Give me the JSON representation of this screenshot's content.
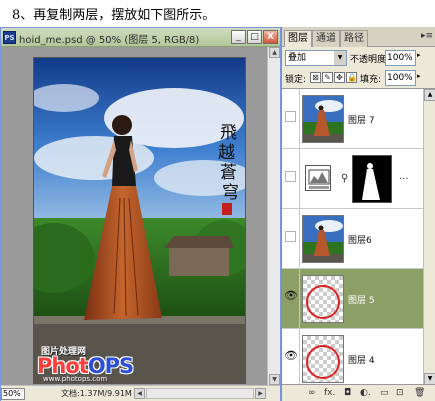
{
  "caption": "8、再复制两层，摆放如下图所示。",
  "document": {
    "app_icon": "PS",
    "title": "hoid_me.psd @ 50% (图层 5, RGB/8)",
    "min_label": "_",
    "max_label": "□",
    "close_label": "X",
    "zoom": "50%",
    "doc_info": "文档:1.37M/9.91M",
    "watermark_line1": "图片处理网",
    "watermark_logo_a": "Phot",
    "watermark_logo_b": "OPS",
    "watermark_url": "www.photops.com"
  },
  "layers_panel": {
    "tabs": [
      "图层",
      "通道",
      "路径"
    ],
    "active_tab": 0,
    "close_label": "x",
    "menu_icon": "▸≡",
    "blend_mode": "叠加",
    "opacity_label": "不透明度:",
    "opacity": "100%",
    "lock_label": "锁定:",
    "lock_icons": [
      "⊠",
      "✎",
      "✥",
      "🔒"
    ],
    "fill_label": "填充:",
    "fill": "100%",
    "layers": [
      {
        "name": "图层 7",
        "visible": false,
        "selected": false,
        "kind": "photo"
      },
      {
        "name": "",
        "visible": false,
        "selected": false,
        "kind": "adjustment"
      },
      {
        "name": "图层6",
        "visible": false,
        "selected": false,
        "kind": "photo"
      },
      {
        "name": "图层 5",
        "visible": true,
        "selected": true,
        "kind": "circle"
      },
      {
        "name": "图层 4",
        "visible": true,
        "selected": false,
        "kind": "circle"
      }
    ],
    "bottom_icons": [
      "∞",
      "fx.",
      "◘",
      "◐.",
      "▭",
      "⊡",
      "🗑"
    ]
  },
  "icons": {
    "eye": "eye-icon",
    "link": "link-icon",
    "trash": "trash-icon"
  },
  "colors": {
    "selected_layer": "#8c9f66",
    "ring": "#e02020"
  }
}
